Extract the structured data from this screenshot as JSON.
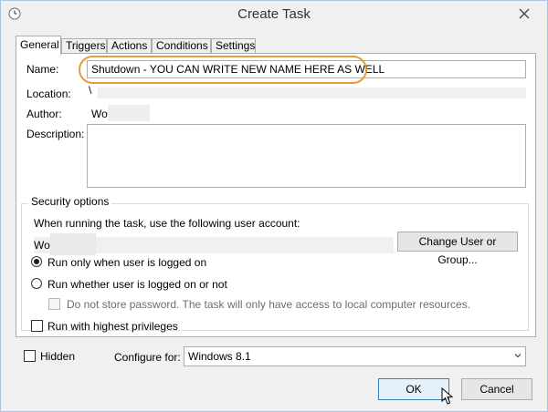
{
  "window": {
    "title": "Create Task"
  },
  "tabs": [
    {
      "label": "General",
      "active": true
    },
    {
      "label": "Triggers",
      "active": false
    },
    {
      "label": "Actions",
      "active": false
    },
    {
      "label": "Conditions",
      "active": false
    },
    {
      "label": "Settings",
      "active": false
    }
  ],
  "general": {
    "name_label": "Name:",
    "name_value": "Shutdown - YOU CAN WRITE NEW NAME HERE AS WELL",
    "location_label": "Location:",
    "location_value": "\\",
    "author_label": "Author:",
    "author_value": "Wo",
    "description_label": "Description:",
    "description_value": ""
  },
  "security": {
    "title": "Security options",
    "account_prompt": "When running the task, use the following user account:",
    "account_value": "Wo",
    "change_button": "Change User or Group...",
    "run_logged_on": "Run only when user is logged on",
    "run_whether": "Run whether user is logged on or not",
    "no_store_password": "Do not store password.  The task will only have access to local computer resources.",
    "highest_privileges": "Run with highest privileges"
  },
  "footer": {
    "hidden_label": "Hidden",
    "configure_label": "Configure for:",
    "configure_value": "Windows 8.1",
    "ok_button": "OK",
    "cancel_button": "Cancel"
  },
  "colors": {
    "highlight": "#e89a3c",
    "window_border": "#a9c4e4"
  },
  "icons": {
    "title_icon": "clock-icon",
    "close": "close-icon",
    "dropdown": "chevron-down-icon",
    "cursor": "mouse-pointer-icon"
  }
}
